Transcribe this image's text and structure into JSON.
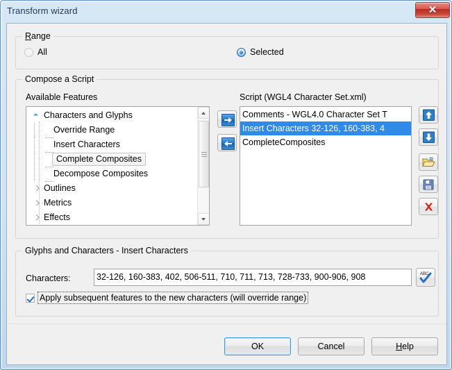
{
  "window": {
    "title": "Transform wizard",
    "close_label": "✕"
  },
  "range": {
    "legend": "Range",
    "legend_accel": "R",
    "options": [
      {
        "label": "All",
        "selected": false,
        "enabled": false
      },
      {
        "label": "Selected",
        "selected": true,
        "enabled": true
      }
    ]
  },
  "compose": {
    "legend": "Compose a Script",
    "available_label": "Available Features",
    "script_label": "Script (WGL4 Character Set.xml)",
    "tree": [
      {
        "label": "Characters and Glyphs",
        "level": 0,
        "state": "expanded",
        "hovered": false
      },
      {
        "label": "Override Range",
        "level": 1,
        "state": "leaf",
        "hovered": false
      },
      {
        "label": "Insert Characters",
        "level": 1,
        "state": "leaf",
        "hovered": false
      },
      {
        "label": "Complete Composites",
        "level": 1,
        "state": "leaf",
        "hovered": true
      },
      {
        "label": "Decompose Composites",
        "level": 1,
        "state": "leaf",
        "hovered": false
      },
      {
        "label": "Outlines",
        "level": 0,
        "state": "collapsed",
        "hovered": false
      },
      {
        "label": "Metrics",
        "level": 0,
        "state": "collapsed",
        "hovered": false
      },
      {
        "label": "Effects",
        "level": 0,
        "state": "collapsed",
        "hovered": false
      }
    ],
    "script_items": [
      {
        "label": "Comments - WGL4.0 Character Set T",
        "selected": false
      },
      {
        "label": "Insert Characters 32-126, 160-383, 4",
        "selected": true
      },
      {
        "label": "CompleteComposites",
        "selected": false
      }
    ],
    "transfer": {
      "add_icon": "arrow-right-icon",
      "remove_icon": "arrow-left-icon"
    },
    "tools": [
      {
        "name": "move-up-button",
        "icon": "arrow-up-icon"
      },
      {
        "name": "move-down-button",
        "icon": "arrow-down-icon"
      },
      {
        "name": "open-button",
        "icon": "open-folder-icon"
      },
      {
        "name": "save-button",
        "icon": "floppy-disk-icon"
      },
      {
        "name": "delete-button",
        "icon": "red-x-icon"
      }
    ]
  },
  "glyphs": {
    "legend": "Glyphs and Characters - Insert Characters",
    "characters_label": "Characters:",
    "characters_value": "32-126, 160-383, 402, 506-511, 710, 711, 713, 728-733, 900-906, 908",
    "characters_placeholder": "",
    "spellcheck_icon": "abc-checkmark-icon",
    "apply_checkbox": {
      "label": "Apply subsequent features to the new characters (will override range)",
      "checked": true
    }
  },
  "footer": {
    "ok_label": "OK",
    "cancel_label": "Cancel",
    "help_label": "Help",
    "help_accel": "H"
  },
  "colors": {
    "selection_blue": "#2f8ae8",
    "titlebar_blue": "#cfe2f3",
    "close_red": "#b82c23",
    "accent_focus": "#3c9ade"
  }
}
